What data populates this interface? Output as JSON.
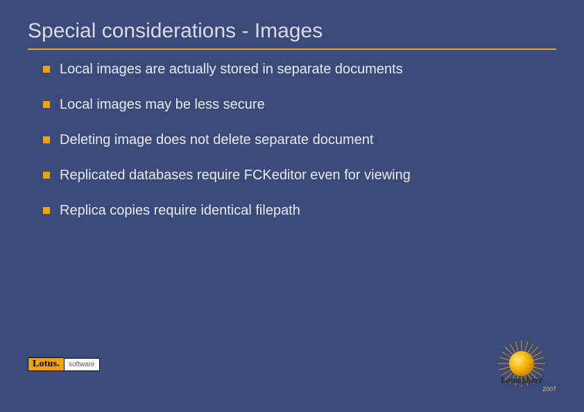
{
  "title": "Special considerations - Images",
  "bullets": [
    "Local images are actually stored in separate documents",
    "Local images may be less secure",
    "Deleting image does not delete separate document",
    "Replicated databases require FCKeditor even for viewing",
    "Replica copies require identical filepath"
  ],
  "footer": {
    "lotus_brand": "Lotus.",
    "lotus_sub": "software",
    "event_brand": "Lotusphere",
    "event_year": "2007"
  },
  "colors": {
    "background": "#3a4b7a",
    "accent": "#f0a400",
    "text": "#e9eaf0",
    "title": "#d9dbe6"
  }
}
